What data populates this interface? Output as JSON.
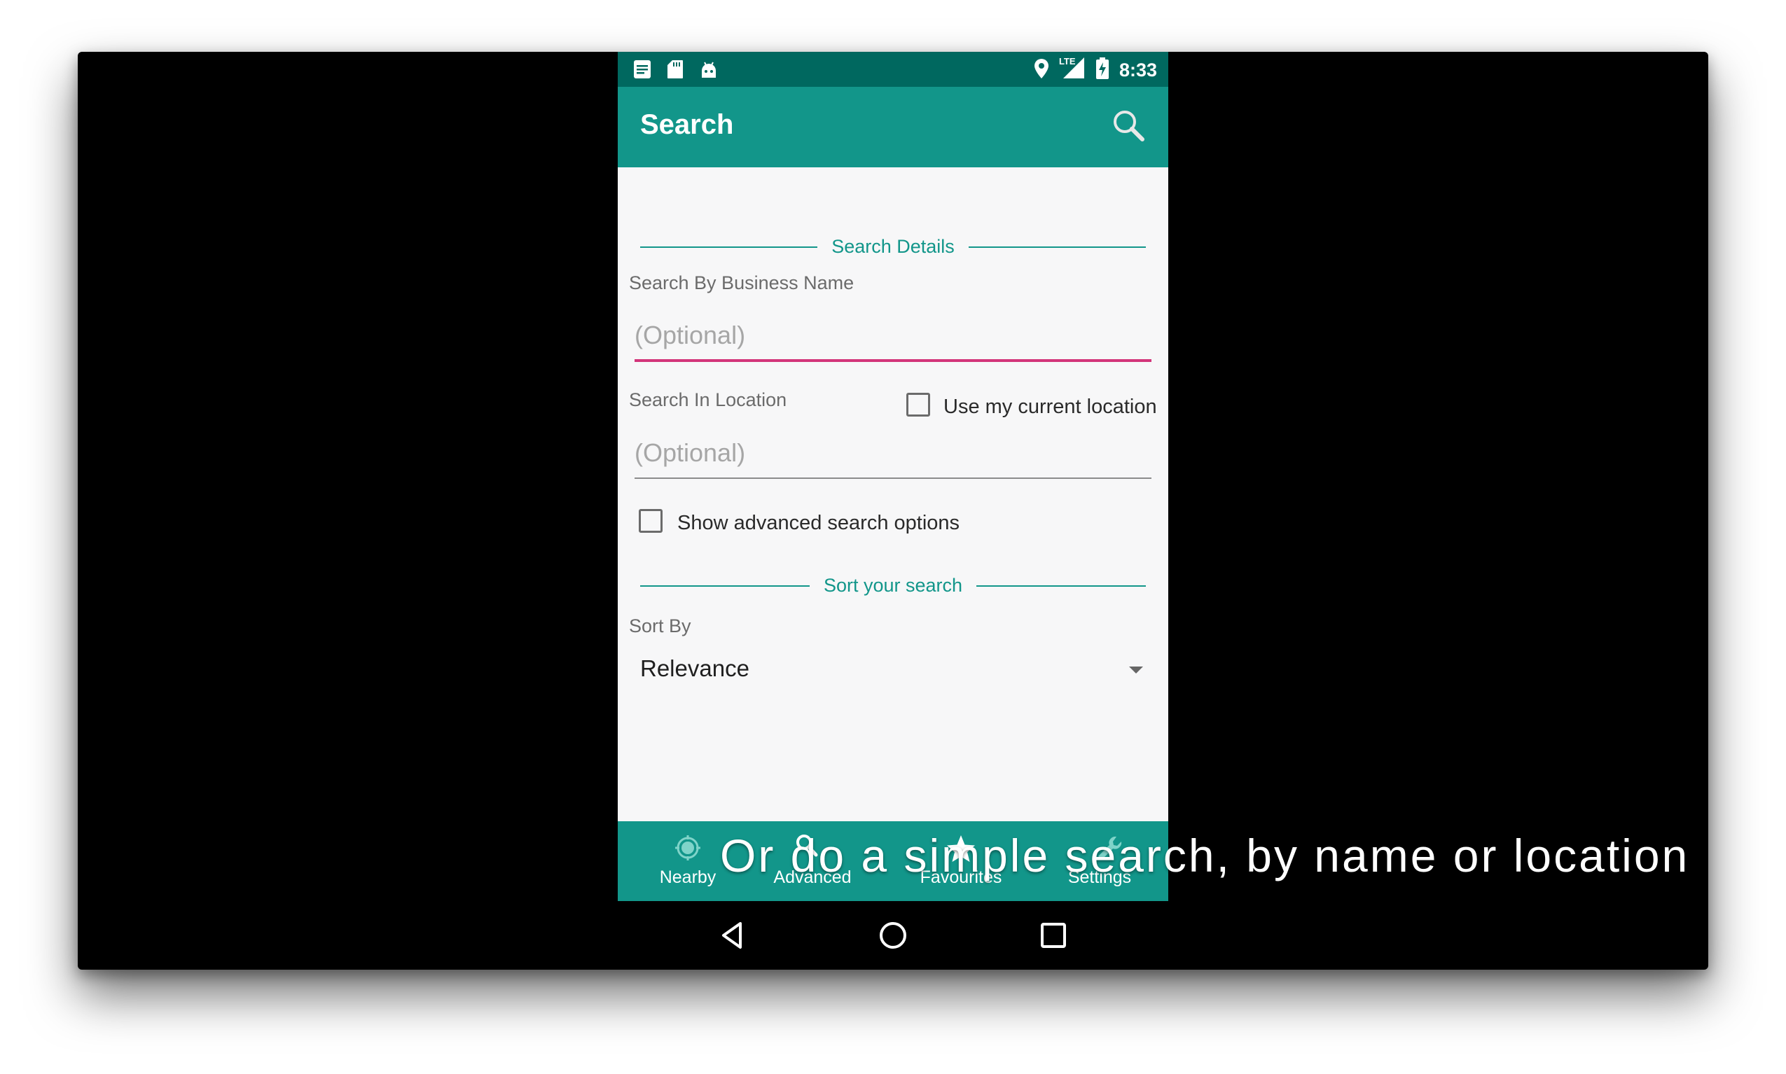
{
  "status_bar": {
    "time": "8:33",
    "left_icons": [
      "notes-icon",
      "sd-card-icon",
      "android-icon"
    ],
    "right_icons": [
      "location-pin-icon",
      "lte-signal-icon",
      "battery-charging-icon"
    ],
    "network_label": "LTE"
  },
  "app_bar": {
    "title": "Search",
    "search_icon": "search-icon"
  },
  "form": {
    "section_details": "Search Details",
    "business_label": "Search By Business Name",
    "business_placeholder": "(Optional)",
    "location_label": "Search In Location",
    "use_location_label": "Use my current location",
    "use_location_checked": false,
    "location_placeholder": "(Optional)",
    "advanced_label": "Show advanced search options",
    "advanced_checked": false,
    "section_sort": "Sort your search",
    "sort_label": "Sort By",
    "sort_value": "Relevance"
  },
  "bottom_nav": {
    "items": [
      {
        "label": "Nearby",
        "icon": "nearby-icon"
      },
      {
        "label": "Advanced",
        "icon": "advanced-search-icon"
      },
      {
        "label": "Favourites",
        "icon": "star-icon"
      },
      {
        "label": "Settings",
        "icon": "wrench-icon"
      }
    ]
  },
  "system_nav": {
    "back": "back-icon",
    "home": "home-icon",
    "recents": "recents-icon"
  },
  "caption": "Or do a simple search, by name or location",
  "colors": {
    "status_bar": "#00685f",
    "primary": "#12968a",
    "accent": "#d3357a",
    "background": "#f7f7f8"
  }
}
